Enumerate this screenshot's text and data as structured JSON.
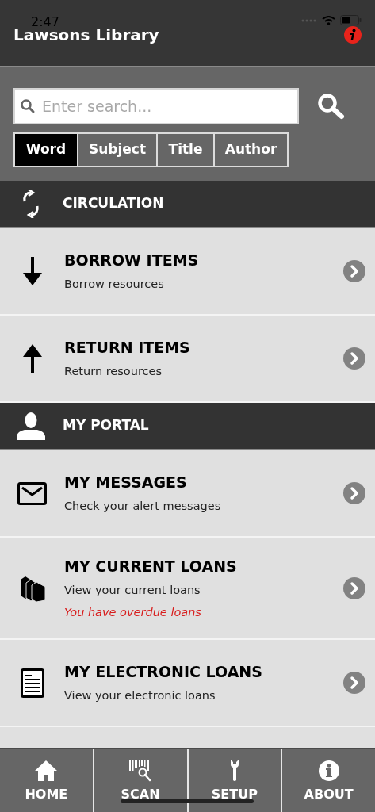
{
  "status_bar": {
    "time": "2:47"
  },
  "header": {
    "title": "Lawsons Library"
  },
  "search": {
    "placeholder": "Enter search..."
  },
  "search_tabs": [
    {
      "label": "Word",
      "selected": true
    },
    {
      "label": "Subject",
      "selected": false
    },
    {
      "label": "Title",
      "selected": false
    },
    {
      "label": "Author",
      "selected": false
    }
  ],
  "sections": [
    {
      "title": "CIRCULATION",
      "items": [
        {
          "title": "BORROW ITEMS",
          "subtitle": "Borrow resources"
        },
        {
          "title": "RETURN ITEMS",
          "subtitle": "Return resources"
        }
      ]
    },
    {
      "title": "MY PORTAL",
      "items": [
        {
          "title": "MY MESSAGES",
          "subtitle": "Check your alert messages"
        },
        {
          "title": "MY CURRENT LOANS",
          "subtitle": "View your current loans",
          "alert": "You have overdue loans"
        },
        {
          "title": "MY ELECTRONIC LOANS",
          "subtitle": "View your electronic loans"
        }
      ]
    }
  ],
  "tab_bar": [
    {
      "label": "HOME"
    },
    {
      "label": "SCAN"
    },
    {
      "label": "SETUP"
    },
    {
      "label": "ABOUT"
    }
  ]
}
